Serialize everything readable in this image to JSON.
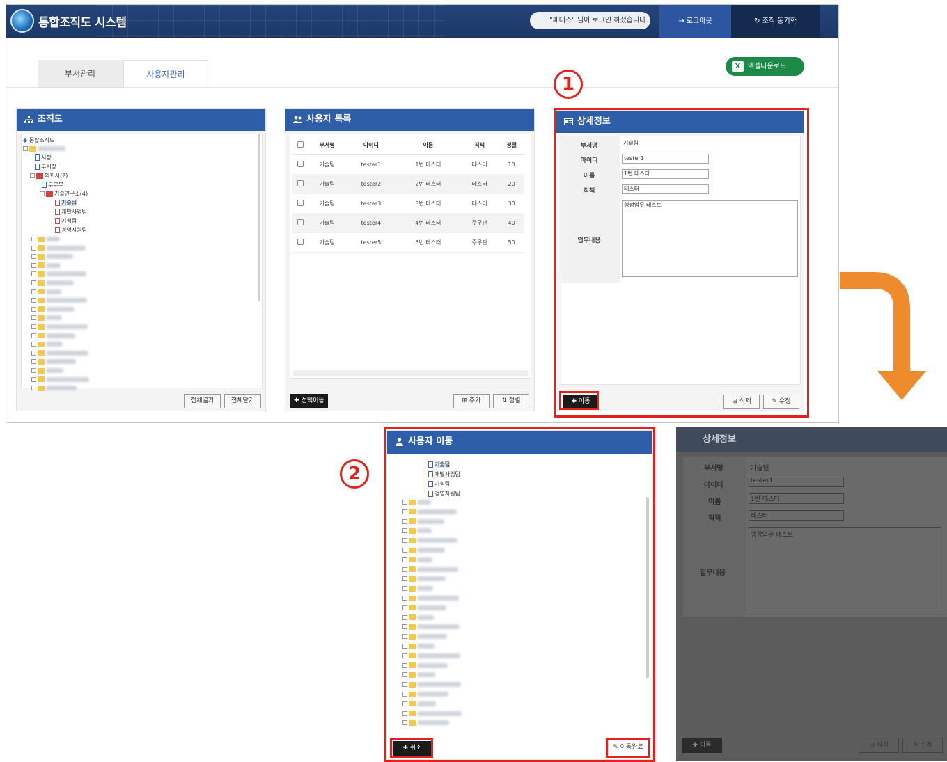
{
  "header": {
    "app_title": "통합조직도 시스템",
    "login_message": "\"패데스\" 님이 로그인 하셨습니다.",
    "logout_label": "로그아웃",
    "sync_label": "조직 동기화"
  },
  "tabs": [
    {
      "label": "부서관리"
    },
    {
      "label": "사용자관리"
    }
  ],
  "excel_label": "엑셀다운로드",
  "org_panel": {
    "title": "조직도",
    "tree_root": "통합조직도",
    "nodes": [
      "시장",
      "부시장",
      "의회사(2)",
      "부부부",
      "기술연구소(4)",
      "기술팀",
      "개발사업팀",
      "기획팀",
      "경영지원팀"
    ],
    "expand_all": "전체열기",
    "collapse_all": "전체닫기"
  },
  "user_panel": {
    "title": "사용자 목록",
    "columns": [
      "부서명",
      "아이디",
      "이름",
      "직책",
      "정렬"
    ],
    "rows": [
      {
        "dept": "기술팀",
        "id": "tester1",
        "name": "1번 테스터",
        "title": "테스터",
        "order": "10"
      },
      {
        "dept": "기술팀",
        "id": "tester2",
        "name": "2번 테스터",
        "title": "테스터",
        "order": "20"
      },
      {
        "dept": "기술팀",
        "id": "tester3",
        "name": "3번 테스터",
        "title": "테스터",
        "order": "30"
      },
      {
        "dept": "기술팀",
        "id": "tester4",
        "name": "4번 테스터",
        "title": "주무관",
        "order": "40"
      },
      {
        "dept": "기술팀",
        "id": "tester5",
        "name": "5번 테스터",
        "title": "주무관",
        "order": "50"
      }
    ],
    "move_selected": "선택이동",
    "add": "추가",
    "sort": "정렬"
  },
  "detail_panel": {
    "title": "상세정보",
    "labels": {
      "dept": "부서명",
      "id": "아이디",
      "name": "이름",
      "title": "직책",
      "work": "업무내용"
    },
    "values": {
      "dept": "기술팀",
      "id": "tester1",
      "name": "1번 테스터",
      "title": "테스터",
      "work": "행정업무 테스트"
    },
    "move": "이동",
    "delete": "삭제",
    "edit": "수정"
  },
  "move_panel": {
    "title": "사용자 이동",
    "nodes": [
      "기술팀",
      "개발사업팀",
      "기획팀",
      "경영지원팀"
    ],
    "cancel": "취소",
    "complete": "이동완료"
  },
  "markers": {
    "step1": "1",
    "step2": "2"
  },
  "colors": {
    "header_blue": "#2f5ea8",
    "accent_red": "#e0231c",
    "arrow_orange": "#ee8b2d",
    "excel_green": "#1d8a49"
  }
}
